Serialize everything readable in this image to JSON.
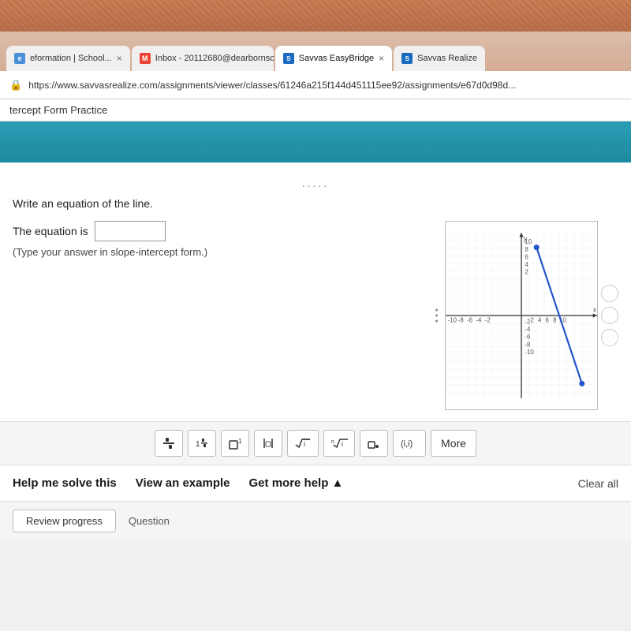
{
  "browser": {
    "tabs": [
      {
        "id": "tab1",
        "label": "eformation | School...",
        "favicon_type": "default",
        "active": false
      },
      {
        "id": "tab2",
        "label": "Inbox - 20112680@dearbornsch...",
        "favicon_type": "gmail",
        "active": false
      },
      {
        "id": "tab3",
        "label": "Savvas EasyBridge",
        "favicon_type": "savvas",
        "active": true
      },
      {
        "id": "tab4",
        "label": "Savvas Realize",
        "favicon_type": "savvas",
        "active": false
      }
    ],
    "url": "https://www.savvasrealize.com/assignments/viewer/classes/61246a215f144d451115ee92/assignments/e67d0d98d..."
  },
  "page": {
    "title": "tercept Form Practice",
    "question_text": "Write an equation of the line.",
    "equation_prefix": "The equation is",
    "equation_placeholder": "",
    "hint_text": "(Type your answer in slope-intercept form.)",
    "dots": "....."
  },
  "math_toolbar": {
    "buttons": [
      {
        "id": "frac",
        "symbol": "⊟",
        "label": "fraction"
      },
      {
        "id": "mixed",
        "symbol": "⊞",
        "label": "mixed number"
      },
      {
        "id": "sup",
        "symbol": "□¹",
        "label": "superscript"
      },
      {
        "id": "abs",
        "symbol": "|□|",
        "label": "absolute value"
      },
      {
        "id": "sqrt",
        "symbol": "√i",
        "label": "square root"
      },
      {
        "id": "nthroot",
        "symbol": "√i",
        "label": "nth root"
      },
      {
        "id": "dot",
        "symbol": "▪.",
        "label": "dot"
      },
      {
        "id": "paren",
        "symbol": "(i,i)",
        "label": "parentheses"
      }
    ],
    "more_label": "More"
  },
  "help_bar": {
    "help_me_solve": "Help me solve this",
    "view_example": "View an example",
    "get_more_help": "Get more help ▲",
    "clear_all": "Clear all"
  },
  "review_bar": {
    "review_progress": "Review progress",
    "question_label": "Question"
  }
}
